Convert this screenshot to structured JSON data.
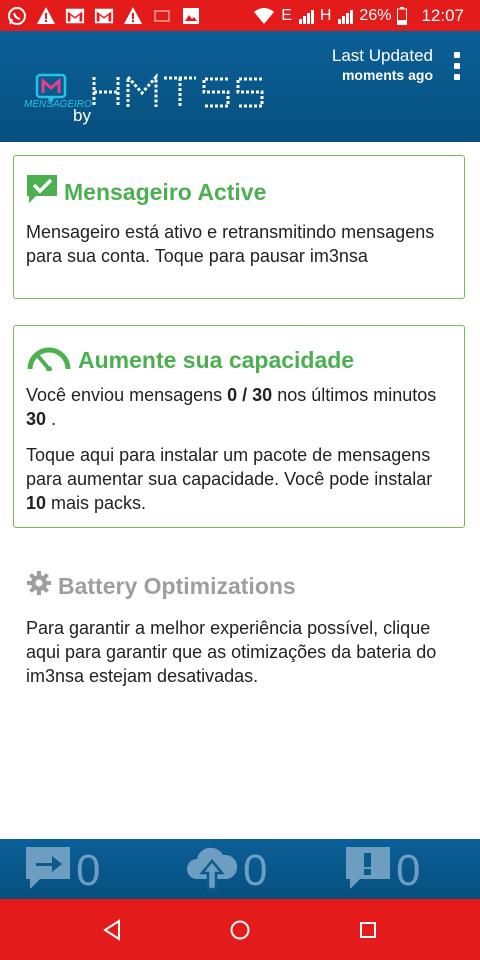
{
  "status_bar": {
    "battery_percent": "26%",
    "time": "12:07",
    "network_1": "E",
    "network_2": "H",
    "left_icons": [
      "whatsapp-icon",
      "alert-icon",
      "gmail-icon",
      "gmail-icon",
      "alert-icon",
      "app-icon",
      "image-icon"
    ]
  },
  "header": {
    "logo_sub": "MENSAGEIRO",
    "logo_by": "by",
    "last_updated_label": "Last Updated",
    "last_updated_value": "moments ago"
  },
  "cards": {
    "active": {
      "title": "Mensageiro Active",
      "body": "Mensageiro está ativo e retransmitindo mensagens para sua conta. Toque para pausar im3nsa"
    },
    "capacity": {
      "title": "Aumente sua capacidade",
      "p1_pre": "Você enviou mensagens ",
      "p1_count": "0 / 30",
      "p1_mid": " nos últimos minutos ",
      "p1_minutes": "30",
      "p1_post": " .",
      "p2_pre": "Toque aqui para instalar um pacote de mensagens para aumentar sua capacidade. Você pode instalar ",
      "p2_packs": "10",
      "p2_post": " mais packs."
    },
    "battery": {
      "title": "Battery Optimizations",
      "body": "Para garantir a melhor experiência possível, clique aqui para garantir que as otimizações da bateria do im3nsa estejam desativadas."
    }
  },
  "counters": {
    "sent": "0",
    "uploaded": "0",
    "errors": "0"
  },
  "colors": {
    "status_bar": "#e41b1b",
    "header": "#0a5f97",
    "green": "#4caf50",
    "card_border": "#79b94f",
    "grey_title": "#9e9e9e"
  }
}
